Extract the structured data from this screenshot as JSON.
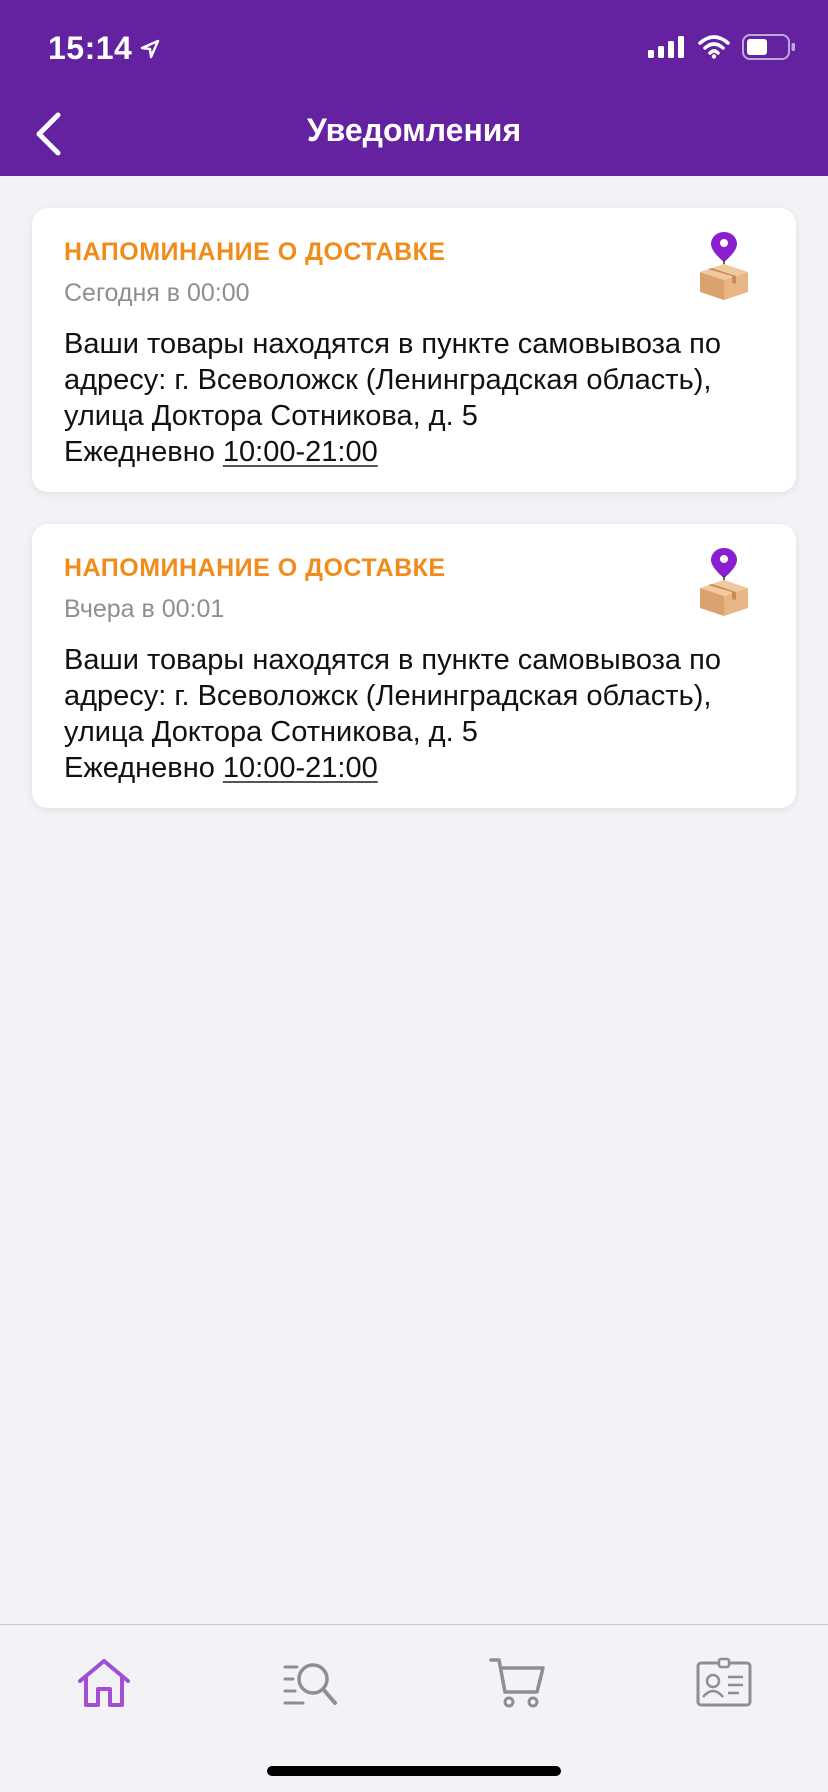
{
  "status_bar": {
    "time": "15:14"
  },
  "header": {
    "title": "Уведомления"
  },
  "colors": {
    "header_bg": "#6522a0",
    "accent_orange": "#f08c1c",
    "tab_active": "#a24fd1",
    "tab_inactive": "#8e8e93"
  },
  "notifications": [
    {
      "title": "НАПОМИНАНИЕ О ДОСТАВКЕ",
      "time": "Сегодня в 00:00",
      "body": "Ваши товары находятся в пункте самовывоза по адресу: г. Всеволожск (Ленинградская область), улица Доктора Сотникова, д. 5",
      "schedule_prefix": "Ежедневно",
      "hours": "10:00-21:00",
      "icon": "package-location-icon"
    },
    {
      "title": "НАПОМИНАНИЕ О ДОСТАВКЕ",
      "time": "Вчера в 00:01",
      "body": "Ваши товары находятся в пункте самовывоза по адресу: г. Всеволожск (Ленинградская область), улица Доктора Сотникова, д. 5",
      "schedule_prefix": "Ежедневно",
      "hours": "10:00-21:00",
      "icon": "package-location-icon"
    }
  ],
  "tabbar": {
    "items": [
      {
        "icon": "home-icon",
        "active": true
      },
      {
        "icon": "search-icon",
        "active": false
      },
      {
        "icon": "cart-icon",
        "active": false
      },
      {
        "icon": "profile-card-icon",
        "active": false
      }
    ]
  }
}
